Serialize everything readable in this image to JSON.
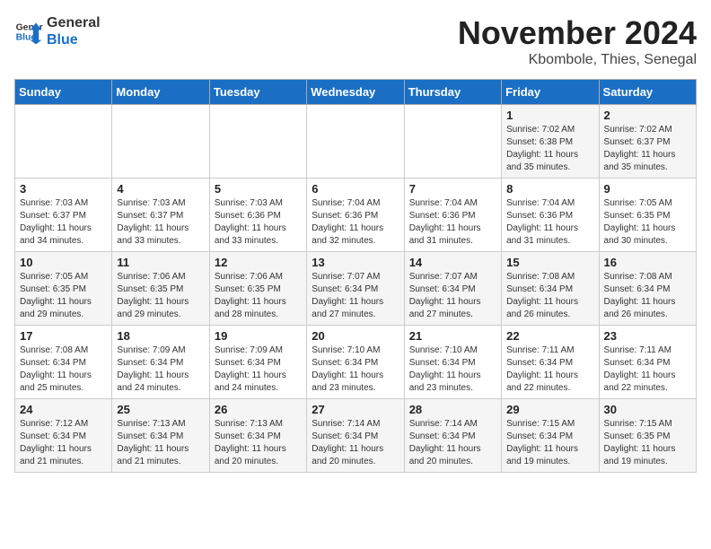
{
  "header": {
    "logo_line1": "General",
    "logo_line2": "Blue",
    "month": "November 2024",
    "location": "Kbombole, Thies, Senegal"
  },
  "weekdays": [
    "Sunday",
    "Monday",
    "Tuesday",
    "Wednesday",
    "Thursday",
    "Friday",
    "Saturday"
  ],
  "weeks": [
    [
      {
        "day": "",
        "info": ""
      },
      {
        "day": "",
        "info": ""
      },
      {
        "day": "",
        "info": ""
      },
      {
        "day": "",
        "info": ""
      },
      {
        "day": "",
        "info": ""
      },
      {
        "day": "1",
        "info": "Sunrise: 7:02 AM\nSunset: 6:38 PM\nDaylight: 11 hours and 35 minutes."
      },
      {
        "day": "2",
        "info": "Sunrise: 7:02 AM\nSunset: 6:37 PM\nDaylight: 11 hours and 35 minutes."
      }
    ],
    [
      {
        "day": "3",
        "info": "Sunrise: 7:03 AM\nSunset: 6:37 PM\nDaylight: 11 hours and 34 minutes."
      },
      {
        "day": "4",
        "info": "Sunrise: 7:03 AM\nSunset: 6:37 PM\nDaylight: 11 hours and 33 minutes."
      },
      {
        "day": "5",
        "info": "Sunrise: 7:03 AM\nSunset: 6:36 PM\nDaylight: 11 hours and 33 minutes."
      },
      {
        "day": "6",
        "info": "Sunrise: 7:04 AM\nSunset: 6:36 PM\nDaylight: 11 hours and 32 minutes."
      },
      {
        "day": "7",
        "info": "Sunrise: 7:04 AM\nSunset: 6:36 PM\nDaylight: 11 hours and 31 minutes."
      },
      {
        "day": "8",
        "info": "Sunrise: 7:04 AM\nSunset: 6:36 PM\nDaylight: 11 hours and 31 minutes."
      },
      {
        "day": "9",
        "info": "Sunrise: 7:05 AM\nSunset: 6:35 PM\nDaylight: 11 hours and 30 minutes."
      }
    ],
    [
      {
        "day": "10",
        "info": "Sunrise: 7:05 AM\nSunset: 6:35 PM\nDaylight: 11 hours and 29 minutes."
      },
      {
        "day": "11",
        "info": "Sunrise: 7:06 AM\nSunset: 6:35 PM\nDaylight: 11 hours and 29 minutes."
      },
      {
        "day": "12",
        "info": "Sunrise: 7:06 AM\nSunset: 6:35 PM\nDaylight: 11 hours and 28 minutes."
      },
      {
        "day": "13",
        "info": "Sunrise: 7:07 AM\nSunset: 6:34 PM\nDaylight: 11 hours and 27 minutes."
      },
      {
        "day": "14",
        "info": "Sunrise: 7:07 AM\nSunset: 6:34 PM\nDaylight: 11 hours and 27 minutes."
      },
      {
        "day": "15",
        "info": "Sunrise: 7:08 AM\nSunset: 6:34 PM\nDaylight: 11 hours and 26 minutes."
      },
      {
        "day": "16",
        "info": "Sunrise: 7:08 AM\nSunset: 6:34 PM\nDaylight: 11 hours and 26 minutes."
      }
    ],
    [
      {
        "day": "17",
        "info": "Sunrise: 7:08 AM\nSunset: 6:34 PM\nDaylight: 11 hours and 25 minutes."
      },
      {
        "day": "18",
        "info": "Sunrise: 7:09 AM\nSunset: 6:34 PM\nDaylight: 11 hours and 24 minutes."
      },
      {
        "day": "19",
        "info": "Sunrise: 7:09 AM\nSunset: 6:34 PM\nDaylight: 11 hours and 24 minutes."
      },
      {
        "day": "20",
        "info": "Sunrise: 7:10 AM\nSunset: 6:34 PM\nDaylight: 11 hours and 23 minutes."
      },
      {
        "day": "21",
        "info": "Sunrise: 7:10 AM\nSunset: 6:34 PM\nDaylight: 11 hours and 23 minutes."
      },
      {
        "day": "22",
        "info": "Sunrise: 7:11 AM\nSunset: 6:34 PM\nDaylight: 11 hours and 22 minutes."
      },
      {
        "day": "23",
        "info": "Sunrise: 7:11 AM\nSunset: 6:34 PM\nDaylight: 11 hours and 22 minutes."
      }
    ],
    [
      {
        "day": "24",
        "info": "Sunrise: 7:12 AM\nSunset: 6:34 PM\nDaylight: 11 hours and 21 minutes."
      },
      {
        "day": "25",
        "info": "Sunrise: 7:13 AM\nSunset: 6:34 PM\nDaylight: 11 hours and 21 minutes."
      },
      {
        "day": "26",
        "info": "Sunrise: 7:13 AM\nSunset: 6:34 PM\nDaylight: 11 hours and 20 minutes."
      },
      {
        "day": "27",
        "info": "Sunrise: 7:14 AM\nSunset: 6:34 PM\nDaylight: 11 hours and 20 minutes."
      },
      {
        "day": "28",
        "info": "Sunrise: 7:14 AM\nSunset: 6:34 PM\nDaylight: 11 hours and 20 minutes."
      },
      {
        "day": "29",
        "info": "Sunrise: 7:15 AM\nSunset: 6:34 PM\nDaylight: 11 hours and 19 minutes."
      },
      {
        "day": "30",
        "info": "Sunrise: 7:15 AM\nSunset: 6:35 PM\nDaylight: 11 hours and 19 minutes."
      }
    ]
  ]
}
